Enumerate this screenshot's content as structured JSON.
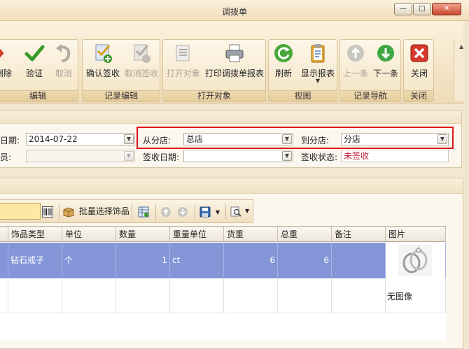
{
  "window": {
    "title": "调拨单",
    "min": "—",
    "max": "□",
    "close": "✕"
  },
  "ribbon": {
    "groups": [
      {
        "caption": "编辑",
        "buttons": [
          {
            "label": "删除",
            "icon": "delete-x-icon",
            "disabled": false
          },
          {
            "label": "验证",
            "icon": "checkmark-icon",
            "disabled": false
          },
          {
            "label": "取消",
            "icon": "undo-arrow-icon",
            "disabled": true
          }
        ]
      },
      {
        "caption": "记录编辑",
        "buttons": [
          {
            "label": "确认签收",
            "icon": "confirm-sign-icon",
            "disabled": false
          },
          {
            "label": "取消签收",
            "icon": "cancel-sign-icon",
            "disabled": true
          }
        ]
      },
      {
        "caption": "打开对象",
        "buttons": [
          {
            "label": "打开对象",
            "icon": "open-object-icon",
            "disabled": true
          },
          {
            "label": "打印调拨单报表",
            "icon": "printer-icon",
            "disabled": false
          }
        ]
      },
      {
        "caption": "视图",
        "buttons": [
          {
            "label": "刷新",
            "icon": "refresh-icon",
            "disabled": false
          },
          {
            "label": "显示报表",
            "icon": "clipboard-report-icon",
            "disabled": false
          }
        ]
      },
      {
        "caption": "记录导航",
        "buttons": [
          {
            "label": "上一条",
            "icon": "arrow-up-icon",
            "disabled": true
          },
          {
            "label": "下一条",
            "icon": "arrow-down-icon",
            "disabled": false
          }
        ]
      },
      {
        "caption": "关闭",
        "buttons": [
          {
            "label": "关闭",
            "icon": "close-red-icon",
            "disabled": false
          }
        ]
      }
    ]
  },
  "form": {
    "date_label": "日期:",
    "date_value": "2014-07-22",
    "staff_label": "员:",
    "staff_value": "",
    "from_store_label": "从分店:",
    "from_store_value": "总店",
    "to_store_label": "到分店:",
    "to_store_value": "分店",
    "sign_date_label": "签收日期:",
    "sign_date_value": "",
    "sign_status_label": "签收状态:",
    "sign_status_value": "未签收"
  },
  "toolbar": {
    "batch_select_label": "批量选择饰品"
  },
  "grid": {
    "columns": [
      "饰品类型",
      "单位",
      "数量",
      "重量单位",
      "货重",
      "总重",
      "备注",
      "图片"
    ],
    "rows": [
      {
        "type": "钻石戒子",
        "unit": "个",
        "qty": "1",
        "weight_unit": "ct",
        "goods_weight": "6",
        "total_weight": "6",
        "remark": "",
        "image": "ring-image"
      }
    ],
    "no_image_text": "无图像"
  },
  "colors": {
    "highlight": "#e01818",
    "selected_row": "#8496d8",
    "status_text": "#c0203a"
  }
}
